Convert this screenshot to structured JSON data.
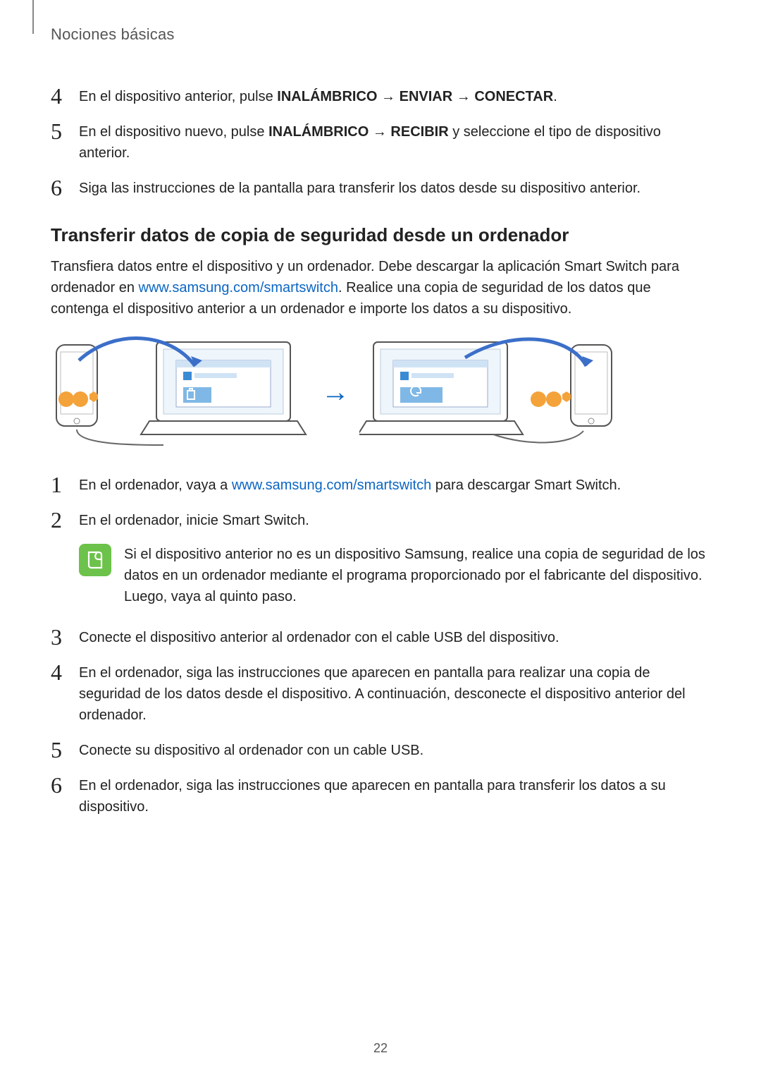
{
  "header": "Nociones básicas",
  "topSteps": [
    {
      "n": "4",
      "segments": [
        {
          "t": "En el dispositivo anterior, pulse "
        },
        {
          "t": "INALÁMBRICO",
          "b": true
        },
        {
          "t": " → "
        },
        {
          "t": "ENVIAR",
          "b": true
        },
        {
          "t": " → "
        },
        {
          "t": "CONECTAR",
          "b": true
        },
        {
          "t": "."
        }
      ]
    },
    {
      "n": "5",
      "segments": [
        {
          "t": "En el dispositivo nuevo, pulse "
        },
        {
          "t": "INALÁMBRICO",
          "b": true
        },
        {
          "t": " → "
        },
        {
          "t": "RECIBIR",
          "b": true
        },
        {
          "t": " y seleccione el tipo de dispositivo anterior."
        }
      ]
    },
    {
      "n": "6",
      "segments": [
        {
          "t": "Siga las instrucciones de la pantalla para transferir los datos desde su dispositivo anterior."
        }
      ]
    }
  ],
  "subheading": "Transferir datos de copia de seguridad desde un ordenador",
  "intro": {
    "before": "Transfiera datos entre el dispositivo y un ordenador. Debe descargar la aplicación Smart Switch para ordenador en ",
    "linkText": "www.samsung.com/smartswitch",
    "after": ". Realice una copia de seguridad de los datos que contenga el dispositivo anterior a un ordenador e importe los datos a su dispositivo."
  },
  "bottomSteps1": [
    {
      "n": "1",
      "segments": [
        {
          "t": "En el ordenador, vaya a "
        },
        {
          "t": "www.samsung.com/smartswitch",
          "link": true
        },
        {
          "t": " para descargar Smart Switch."
        }
      ]
    },
    {
      "n": "2",
      "segments": [
        {
          "t": "En el ordenador, inicie Smart Switch."
        }
      ]
    }
  ],
  "note": "Si el dispositivo anterior no es un dispositivo Samsung, realice una copia de seguridad de los datos en un ordenador mediante el programa proporcionado por el fabricante del dispositivo. Luego, vaya al quinto paso.",
  "bottomSteps2": [
    {
      "n": "3",
      "segments": [
        {
          "t": "Conecte el dispositivo anterior al ordenador con el cable USB del dispositivo."
        }
      ]
    },
    {
      "n": "4",
      "segments": [
        {
          "t": "En el ordenador, siga las instrucciones que aparecen en pantalla para realizar una copia de seguridad de los datos desde el dispositivo. A continuación, desconecte el dispositivo anterior del ordenador."
        }
      ]
    },
    {
      "n": "5",
      "segments": [
        {
          "t": "Conecte su dispositivo al ordenador con un cable USB."
        }
      ]
    },
    {
      "n": "6",
      "segments": [
        {
          "t": "En el ordenador, siga las instrucciones que aparecen en pantalla para transferir los datos a su dispositivo."
        }
      ]
    }
  ],
  "pageNumber": "22"
}
